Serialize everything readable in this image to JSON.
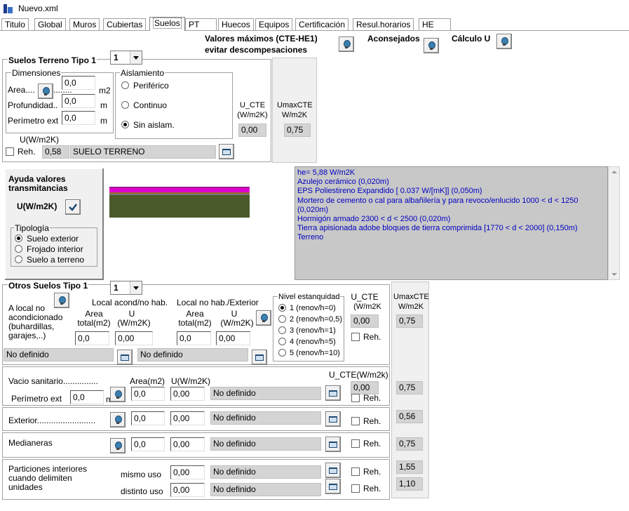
{
  "window": {
    "title": "Nuevo.xml"
  },
  "tabs": [
    {
      "label": "Titulo"
    },
    {
      "label": "Global"
    },
    {
      "label": "Muros"
    },
    {
      "label": "Cubiertas"
    },
    {
      "label": "Suelos"
    },
    {
      "label": "PT"
    },
    {
      "label": "Huecos"
    },
    {
      "label": "Equipos"
    },
    {
      "label": "Certificación"
    },
    {
      "label": "Resul.horarios"
    },
    {
      "label": "HE"
    }
  ],
  "active_tab": "Suelos",
  "header": {
    "valores_line1": "Valores máximos (CTE-HE1)",
    "valores_line2": "evitar descompesaciones",
    "aconsejados": "Aconsejados",
    "calculo_u": "Cálculo U"
  },
  "terreno": {
    "title": "Suelos Terreno Tipo 1",
    "tipo_value": "1",
    "dimensiones_label": "Dimensiones",
    "area_label": "Area....",
    "area_dots": "........",
    "area_value": "0,0",
    "area_unit": "m2",
    "prof_label": "Profundidad..",
    "prof_value": "0,0",
    "prof_unit": "m",
    "perim_label": "Perímetro ext",
    "perim_value": "0,0",
    "perim_unit": "m",
    "aislamiento_label": "Aislamiento",
    "aislamiento_options": [
      "Periférico",
      "Continuo",
      "Sin aislam."
    ],
    "aislamiento_selected": "Sin aislam.",
    "u_label": "U(W/m2K)",
    "reh_label": "Reh.",
    "u_value": "0,58",
    "material": "SUELO TERRENO",
    "ucte_label1": "U_CTE",
    "ucte_label2": "(W/m2K)",
    "ucte_value": "0,00",
    "umax_label1": "UmaxCTE",
    "umax_label2": "W/m2K",
    "umax_value": "0,75"
  },
  "ayuda": {
    "title1": "Ayuda valores",
    "title2": "transmitancias",
    "u_label": "U(W/m2K)",
    "tipologia_label": "Tipología",
    "options": [
      "Suelo exterior",
      "Frojado interior",
      "Suelo a terreno"
    ],
    "selected": "Suelo exterior"
  },
  "layers": {
    "lines": [
      "he= 5,88 W/m2K",
      "Azulejo cerámico (0,020m)",
      "EPS Poliestireno Expandido [ 0.037 W/[mK]] (0,050m)",
      "Mortero de cemento o cal para albañilería y para revoco/enlucido 1000 < d < 1250 (0,020m)",
      "Hormigón armado 2300 < d < 2500 (0,020m)",
      "Tierra apisionada adobe bloques de tierra comprimida [1770 < d < 2000] (0,150m)",
      "Terreno"
    ]
  },
  "otros": {
    "title": "Otros Suelos Tipo 1",
    "tipo_value": "1",
    "a_local": "A local no",
    "acond": "acondicionado",
    "buhard": "(buhardillas,",
    "garajes": "garajes,..)",
    "local_acond": "Local acond/no hab.",
    "local_nohab": "Local no hab./Exterior",
    "area_h1": "Area",
    "area_h2": "total(m2)",
    "u_h1": "U",
    "u_h2": "(W/m2K)",
    "area1": "0,0",
    "u1": "0,00",
    "area2": "0,0",
    "u2": "0,00",
    "mat1": "No definido",
    "mat2": "No definido",
    "nivel_label": "Nivel estanquidad",
    "nivel_options": [
      "1 (renov/h=0)",
      "2 (renov/h=0,5)",
      "3 (renov/h=1)",
      "4 (renov/h=5)",
      "5 (renov/h=10)"
    ],
    "nivel_selected": "1 (renov/h=0)",
    "ucte_label1": "U_CTE",
    "ucte_label2": "(W/m2K",
    "ucte_value": "0,00",
    "reh_label": "Reh.",
    "umax_label1": "UmaxCTE",
    "umax_label2": "W/m2K",
    "umax_value": "0,75"
  },
  "vacio": {
    "label": "Vacio sanitario...............",
    "area_h": "Area(m2)",
    "u_h": "U(W/m2K)",
    "ucte_h": "U_CTE(W/m2k)",
    "perim_label": "Perímetro ext",
    "perim_value": "0,0",
    "perim_unit": "m",
    "area": "0,0",
    "u": "0,00",
    "mat": "No definido",
    "ucte_value": "0,00",
    "reh_label": "Reh.",
    "umax_value": "0,75"
  },
  "exterior": {
    "label": "Exterior.........................",
    "area": "0,0",
    "u": "0,00",
    "mat": "No definido",
    "reh_label": "Reh.",
    "umax_value": "0,56"
  },
  "medianeras": {
    "label": "Medianeras",
    "area": "0,0",
    "u": "0,00",
    "mat": "No definido",
    "reh_label": "Reh.",
    "umax_value": "0,75"
  },
  "particiones": {
    "l1": "Particiones interiores",
    "l2": "cuando delimiten",
    "l3": "unidades",
    "mismo_label": "mismo uso",
    "mismo_u": "0,00",
    "mismo_mat": "No definido",
    "distinto_label": "distinto uso",
    "distinto_u": "0,00",
    "distinto_mat": "No definido",
    "reh_label": "Reh.",
    "umax1": "1,55",
    "umax2": "1,10"
  },
  "colors": {
    "memo_bg": "#c8c8c8",
    "memo_text": "#0000c0",
    "layer_pink": "#e000d0",
    "layer_dark": "#4a5a2a"
  }
}
